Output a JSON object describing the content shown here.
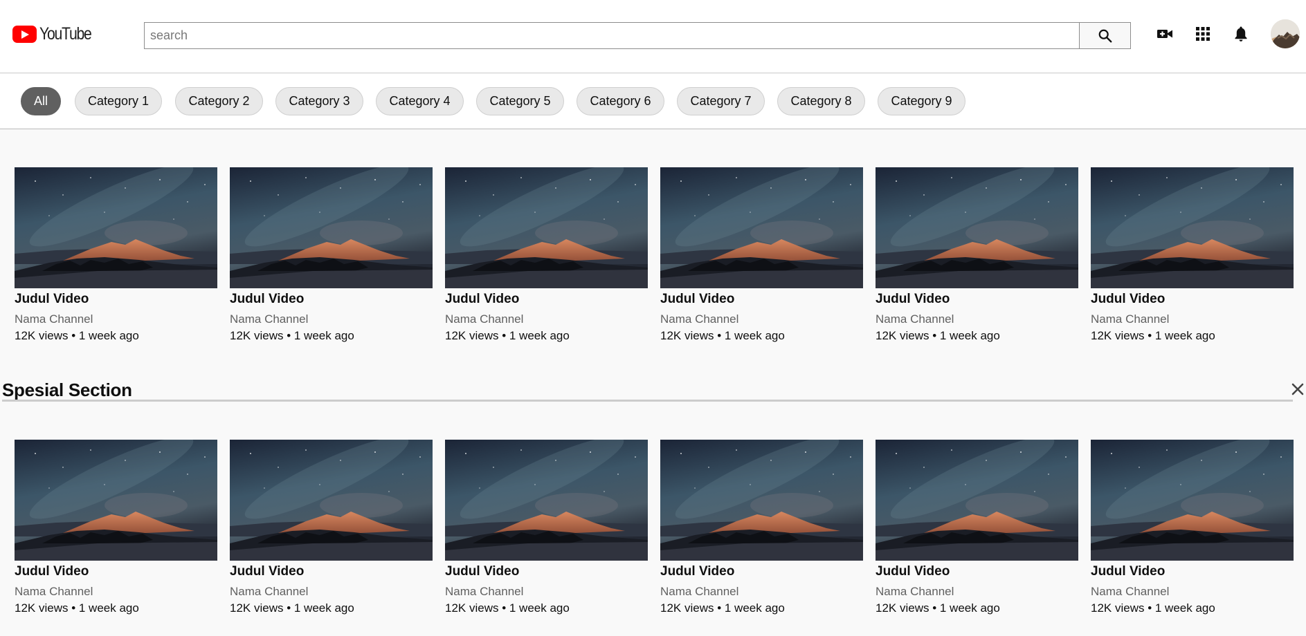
{
  "header": {
    "logo_text": "YouTube",
    "search_placeholder": "search",
    "search_value": "",
    "icons": [
      "video-camera-add-icon",
      "apps-grid-icon",
      "bell-icon"
    ],
    "avatar": "user-avatar"
  },
  "chips": [
    "All",
    "Category 1",
    "Category 2",
    "Category 3",
    "Category 4",
    "Category 5",
    "Category 6",
    "Category 7",
    "Category 8",
    "Category 9"
  ],
  "active_chip": "All",
  "rows": [
    {
      "videos": [
        {
          "title": "Judul Video",
          "channel": "Nama Channel",
          "meta": "12K views • 1 week ago"
        },
        {
          "title": "Judul Video",
          "channel": "Nama Channel",
          "meta": "12K views • 1 week ago"
        },
        {
          "title": "Judul Video",
          "channel": "Nama Channel",
          "meta": "12K views • 1 week ago"
        },
        {
          "title": "Judul Video",
          "channel": "Nama Channel",
          "meta": "12K views • 1 week ago"
        },
        {
          "title": "Judul Video",
          "channel": "Nama Channel",
          "meta": "12K views • 1 week ago"
        },
        {
          "title": "Judul Video",
          "channel": "Nama Channel",
          "meta": "12K views • 1 week ago"
        }
      ]
    },
    {
      "videos": [
        {
          "title": "Judul Video",
          "channel": "Nama Channel",
          "meta": "12K views • 1 week ago"
        },
        {
          "title": "Judul Video",
          "channel": "Nama Channel",
          "meta": "12K views • 1 week ago"
        },
        {
          "title": "Judul Video",
          "channel": "Nama Channel",
          "meta": "12K views • 1 week ago"
        },
        {
          "title": "Judul Video",
          "channel": "Nama Channel",
          "meta": "12K views • 1 week ago"
        },
        {
          "title": "Judul Video",
          "channel": "Nama Channel",
          "meta": "12K views • 1 week ago"
        },
        {
          "title": "Judul Video",
          "channel": "Nama Channel",
          "meta": "12K views • 1 week ago"
        }
      ]
    }
  ],
  "special_section": {
    "title": "Spesial Section",
    "close_icon": "close-icon"
  },
  "colors": {
    "brand": "#ff0000",
    "chip_active": "#606060",
    "chip_bg": "#e9e9e9",
    "background": "#f9f9f9"
  }
}
